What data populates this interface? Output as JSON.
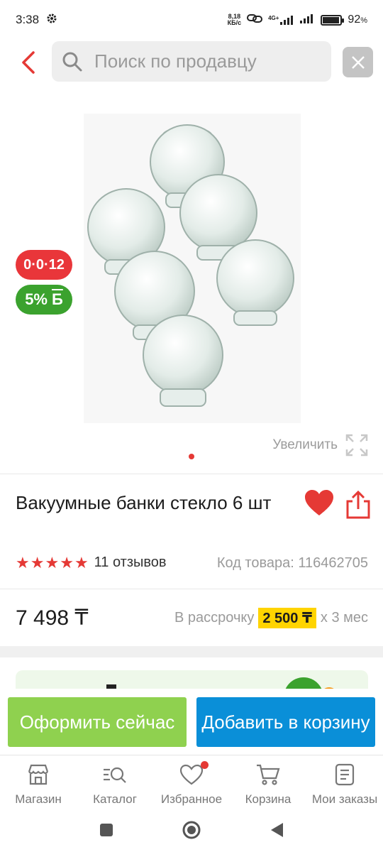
{
  "status_bar": {
    "time": "3:38",
    "net_speed_top": "8,18",
    "net_speed_bottom": "КБ/с",
    "network": "4G+",
    "battery": "92",
    "battery_unit": "%",
    "battery_level": 0.92
  },
  "search": {
    "placeholder": "Поиск по продавцу"
  },
  "product": {
    "badge_installment": "0·0·12",
    "badge_bonus_percent": "5%",
    "badge_bonus_icon": "Б",
    "zoom_label": "Увеличить",
    "title": "Вакуумные банки стекло 6 шт",
    "rating": 5,
    "reviews": "11 отзывов",
    "sku_label": "Код товара: 116462705",
    "price": "7 498 ₸",
    "installment_prefix": "В рассрочку",
    "installment_amount": "2 500 ₸",
    "installment_suffix": "x 3 мес"
  },
  "actions": {
    "buy_now": "Оформить сейчас",
    "add_to_cart": "Добавить в корзину"
  },
  "bottom_nav": {
    "items": [
      {
        "label": "Магазин",
        "icon": "shop-icon"
      },
      {
        "label": "Каталог",
        "icon": "catalog-search-icon"
      },
      {
        "label": "Избранное",
        "icon": "heart-icon"
      },
      {
        "label": "Корзина",
        "icon": "cart-icon"
      },
      {
        "label": "Мои заказы",
        "icon": "orders-icon"
      }
    ]
  },
  "colors": {
    "accent_red": "#e53935",
    "buy_green": "#8fd14f",
    "cart_blue": "#0a8fd8",
    "installment_yellow": "#ffd400"
  }
}
